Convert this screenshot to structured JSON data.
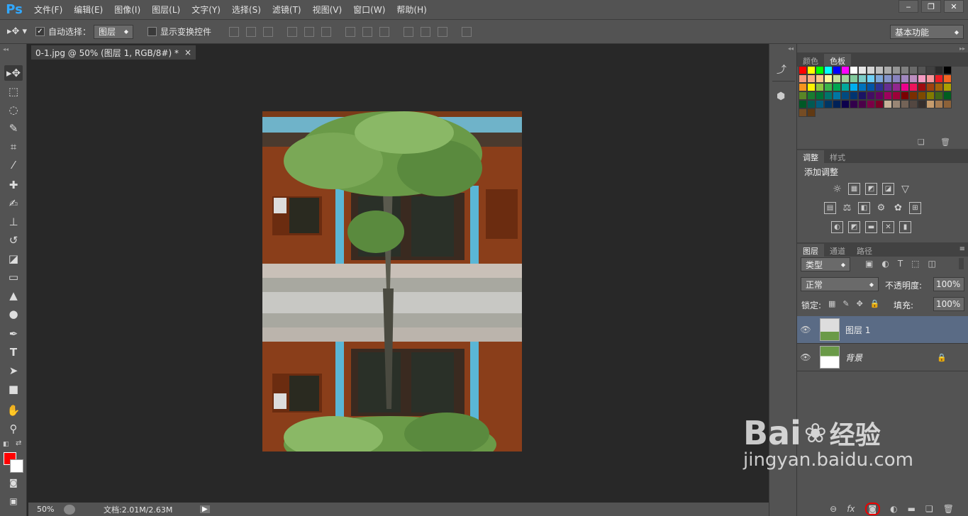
{
  "app": {
    "logo": "Ps"
  },
  "menu": [
    "文件(F)",
    "编辑(E)",
    "图像(I)",
    "图层(L)",
    "文字(Y)",
    "选择(S)",
    "滤镜(T)",
    "视图(V)",
    "窗口(W)",
    "帮助(H)"
  ],
  "options": {
    "auto_select_label": "自动选择：",
    "auto_select_value": "图层",
    "show_transform_label": "显示变换控件",
    "workspace": "基本功能"
  },
  "document": {
    "tab_title": "0-1.jpg @ 50% (图层 1, RGB/8#) *",
    "close": "×"
  },
  "status": {
    "zoom": "50%",
    "doc_info": "文档:2.01M/2.63M"
  },
  "panels": {
    "color_tabs": [
      "颜色",
      "色板"
    ],
    "adjust_tabs": [
      "调整",
      "样式"
    ],
    "adjust_title": "添加调整",
    "layer_tabs": [
      "图层",
      "通道",
      "路径"
    ],
    "layer_filter": "类型",
    "blend_mode": "正常",
    "opacity_label": "不透明度:",
    "opacity_value": "100%",
    "lock_label": "锁定:",
    "fill_label": "填充:",
    "fill_value": "100%",
    "layers": [
      {
        "name": "图层 1",
        "selected": true
      },
      {
        "name": "背景",
        "selected": false
      }
    ]
  },
  "watermark": {
    "brand": "Bai",
    "brand2": "经验",
    "url": "jingyan.baidu.com"
  },
  "colors": {
    "foreground": "#ff0000",
    "background": "#ffffff",
    "selected_layer": "#5a6b85",
    "swatches": [
      "#ff0000",
      "#ffff00",
      "#00ff00",
      "#00ffff",
      "#0000ff",
      "#ff00ff",
      "#ffffff",
      "#e6e6e6",
      "#d4d4d4",
      "#bfbfbf",
      "#aaaaaa",
      "#959595",
      "#808080",
      "#6a6a6a",
      "#555555",
      "#404040",
      "#2b2b2b",
      "#000000",
      "#f7977a",
      "#f9ad81",
      "#fdc68a",
      "#fff79a",
      "#c4df9b",
      "#a3d39c",
      "#82ca9d",
      "#7bcdc8",
      "#6ecff6",
      "#7ea7d8",
      "#8493ca",
      "#8882be",
      "#a187be",
      "#bc8dbf",
      "#f49ac2",
      "#f6989d",
      "#ed1c24",
      "#f26522",
      "#f7941d",
      "#fff200",
      "#8dc63f",
      "#39b54a",
      "#00a651",
      "#00a99d",
      "#00aeef",
      "#0072bc",
      "#0054a6",
      "#2e3192",
      "#662d91",
      "#92278f",
      "#ec008c",
      "#ed145b",
      "#9e0b0f",
      "#a0410d",
      "#a36209",
      "#aba000",
      "#598527",
      "#197b30",
      "#007236",
      "#00746b",
      "#0076a3",
      "#004a80",
      "#003471",
      "#1b1464",
      "#440e62",
      "#630460",
      "#9e005d",
      "#9e0039",
      "#790000",
      "#7b2e00",
      "#7d4900",
      "#827b00",
      "#406618",
      "#005e20",
      "#005826",
      "#005952",
      "#005b7f",
      "#003663",
      "#002157",
      "#0d004c",
      "#32004b",
      "#4b0049",
      "#7b0046",
      "#7a0026",
      "#c7b299",
      "#998675",
      "#736357",
      "#534741",
      "#362f2d",
      "#c69c6d",
      "#a67c52",
      "#8c6239",
      "#754c24",
      "#603913"
    ]
  }
}
